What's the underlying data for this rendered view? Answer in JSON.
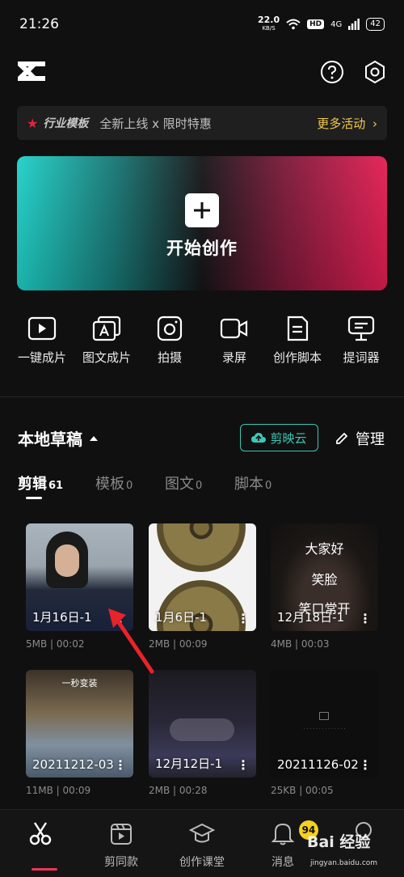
{
  "status_bar": {
    "time": "21:26",
    "speed_value": "22.0",
    "speed_unit": "KB/S",
    "hd_label": "HD",
    "network": "4G",
    "battery": "42"
  },
  "promo": {
    "tag": "行业模板",
    "text": "全新上线 x 限时特惠",
    "more": "更多活动",
    "more_arrow": "›",
    "accent_color": "#f2c94c"
  },
  "create": {
    "label": "开始创作"
  },
  "tools": [
    {
      "label": "一键成片",
      "icon": "play-icon"
    },
    {
      "label": "图文成片",
      "icon": "text-image-icon"
    },
    {
      "label": "拍摄",
      "icon": "camera-icon"
    },
    {
      "label": "录屏",
      "icon": "record-screen-icon"
    },
    {
      "label": "创作脚本",
      "icon": "script-icon"
    },
    {
      "label": "提词器",
      "icon": "teleprompter-icon"
    }
  ],
  "drafts": {
    "title": "本地草稿",
    "cloud_label": "剪映云",
    "manage_label": "管理",
    "cloud_color": "#3ac8b8"
  },
  "tabs": [
    {
      "label": "剪辑",
      "count": "61"
    },
    {
      "label": "模板",
      "count": "0"
    },
    {
      "label": "图文",
      "count": "0"
    },
    {
      "label": "脚本",
      "count": "0"
    }
  ],
  "projects": [
    {
      "title": "1月16日-1",
      "size": "5MB",
      "duration": "00:02"
    },
    {
      "title": "1月6日-1",
      "size": "2MB",
      "duration": "00:09"
    },
    {
      "title": "12月18日-1",
      "size": "4MB",
      "duration": "00:03",
      "captions": [
        "大家好",
        "笑脸",
        "笑口常开"
      ]
    },
    {
      "title": "20211212-03",
      "size": "11MB",
      "duration": "00:09",
      "caption": "一秒变装"
    },
    {
      "title": "12月12日-1",
      "size": "2MB",
      "duration": "00:28"
    },
    {
      "title": "20211126-02",
      "size": "25KB",
      "duration": "00:05"
    }
  ],
  "bottom_nav": [
    {
      "label": "",
      "icon": "scissors-icon"
    },
    {
      "label": "剪同款",
      "icon": "template-icon"
    },
    {
      "label": "创作课堂",
      "icon": "graduation-cap-icon"
    },
    {
      "label": "消息",
      "icon": "bell-icon"
    },
    {
      "label": "",
      "icon": "profile-icon"
    }
  ],
  "notification_count": "94",
  "watermark": {
    "text": "Bai 经验",
    "url": "jingyan.baidu.com"
  }
}
